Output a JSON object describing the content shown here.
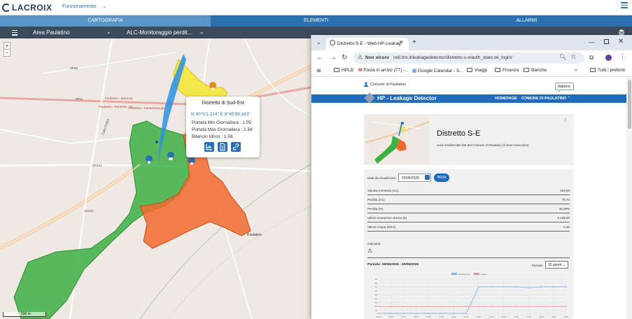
{
  "app": {
    "logo_text": "LACROIX",
    "mode_label": "Funzionamento",
    "mode_caret": "⌄",
    "tabs": [
      {
        "label": "CARTOGRAFIA",
        "active": true
      },
      {
        "label": "ELEMENTI",
        "active": false
      },
      {
        "label": "ALLARMI",
        "active": false
      }
    ],
    "filters": {
      "area": "Area Paulatino",
      "alc": "ALC-Monitoraggio perdit..."
    }
  },
  "map": {
    "zoom_in": "+",
    "zoom_out": "−",
    "scale_label": "500 m",
    "labels": {
      "paulatino_bonorva": "Paulatino - Bonorva",
      "paulatino_sa": "Paulatino - Santulussurgiu",
      "paulatino_ba": "Paulatino - Bonorva - Sa",
      "paulatino": "Paulatino",
      "carlo_felice": "Carlo Felice",
      "sp65": "SP65",
      "sp11": "SP11",
      "sp131": "SP131",
      "ss131": "SS131"
    },
    "popup": {
      "title": "Distretto di Sud-Est",
      "coords": "N 40°5'1.214\" E 8°45'59.183\"",
      "portata_min": "Portata Min Giornaliera : 1.05",
      "portata_max": "Portata Max Giornaliera : 2.58",
      "bilancio": "Bilancio Idrico : 1.56"
    },
    "colors": {
      "green": "#3cb043",
      "orange": "#f26a2e",
      "yellow": "#f5e63a",
      "blue": "#2d8fe0"
    }
  },
  "browser": {
    "tab_title": "Distretto S-E - Web-HP-Leakag",
    "tab_close": "✕",
    "new_tab": "+",
    "not_secure": "Non sicuro",
    "url": "indi.tnx.it/leakagedetector/distretto-s-e/auth_stato:ok_login/",
    "bookmarks": [
      "HPLD",
      "Posta in arrivo (77) -...",
      "Google Calendar - S...",
      "Viaggi",
      "Finanza",
      "Banche",
      "Tutti i preferiti"
    ],
    "more_bookmarks": "»"
  },
  "webpage": {
    "user": "Comune di Paulatino",
    "language": "Italiano",
    "brand": "HP - Leakage Detector",
    "nav_home": "HOMEPAGE",
    "nav_comune": "COMUNE DI PAULATINO",
    "district_name": "Distretto S-E",
    "district_desc": "Area residenziale Est del Comune di Paulatino (Colore Arancione)",
    "date_label": "Data da visualizzare:",
    "date_value": "20/05/2025",
    "send_button": "INVIA",
    "rows": [
      {
        "label": "Volume immesso (mc)",
        "value": "154,86"
      },
      {
        "label": "Perdita (mc)",
        "value": "70,74"
      },
      {
        "label": "Perdita (%)",
        "value": "45,68%"
      },
      {
        "label": "Valore economico annuo (€)",
        "value": "5.105,60"
      },
      {
        "label": "Valore Acqua (€/mc)",
        "value": "0,30"
      }
    ],
    "indicators_label": "Indicatori:",
    "period_text": "Periodo: 05/05/2025 - 20/05/2025",
    "period_label": "Periodo",
    "period_value": "15 giorni"
  },
  "chart_data": {
    "type": "line",
    "title": "",
    "x": [
      "05/05",
      "06/05",
      "07/05",
      "08/05",
      "09/05",
      "10/05",
      "11/05",
      "12/05",
      "13/05",
      "14/05",
      "15/05",
      "16/05",
      "17/05",
      "18/05",
      "19/05",
      "20/05"
    ],
    "series": [
      {
        "name": "Perdita (mc)",
        "color": "#7fb3e8",
        "values": [
          2,
          2,
          2,
          2,
          2,
          2,
          2,
          2,
          70,
          70,
          70,
          70,
          68,
          70,
          70,
          70
        ]
      },
      {
        "name": "Soglia",
        "color": "#f08a9a",
        "values": [
          20,
          20,
          20,
          20,
          20,
          20,
          20,
          20,
          20,
          20,
          20,
          20,
          20,
          20,
          20,
          20
        ]
      }
    ],
    "ylim": [
      0,
      90
    ],
    "grid": true,
    "legend": "top-center"
  }
}
